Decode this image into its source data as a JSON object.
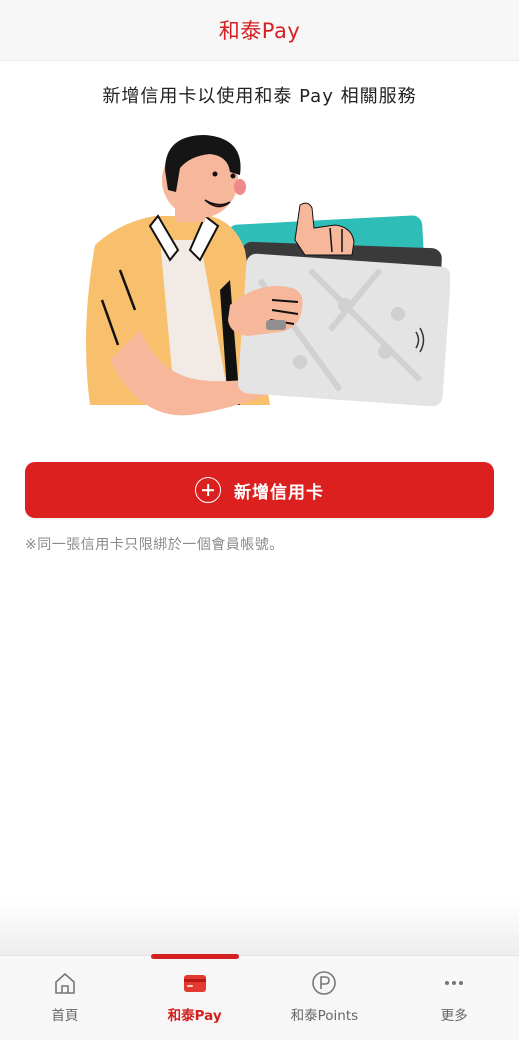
{
  "header": {
    "title": "和泰Pay"
  },
  "main": {
    "headline": "新增信用卡以使用和泰 Pay 相關服務",
    "add_card_button": {
      "label": "新增信用卡",
      "icon": "plus-circle-icon"
    },
    "note": "※同一張信用卡只限綁於一個會員帳號。"
  },
  "tabbar": {
    "tabs": [
      {
        "label": "首頁",
        "icon": "home-icon",
        "active": false
      },
      {
        "label": "和泰Pay",
        "icon": "card-icon",
        "active": true
      },
      {
        "label": "和泰Points",
        "icon": "points-icon",
        "active": false
      },
      {
        "label": "更多",
        "icon": "more-icon",
        "active": false
      }
    ]
  },
  "colors": {
    "brand_red": "#dc1f1f",
    "header_bg": "#f7f7f7",
    "inactive_tab": "#666666"
  }
}
